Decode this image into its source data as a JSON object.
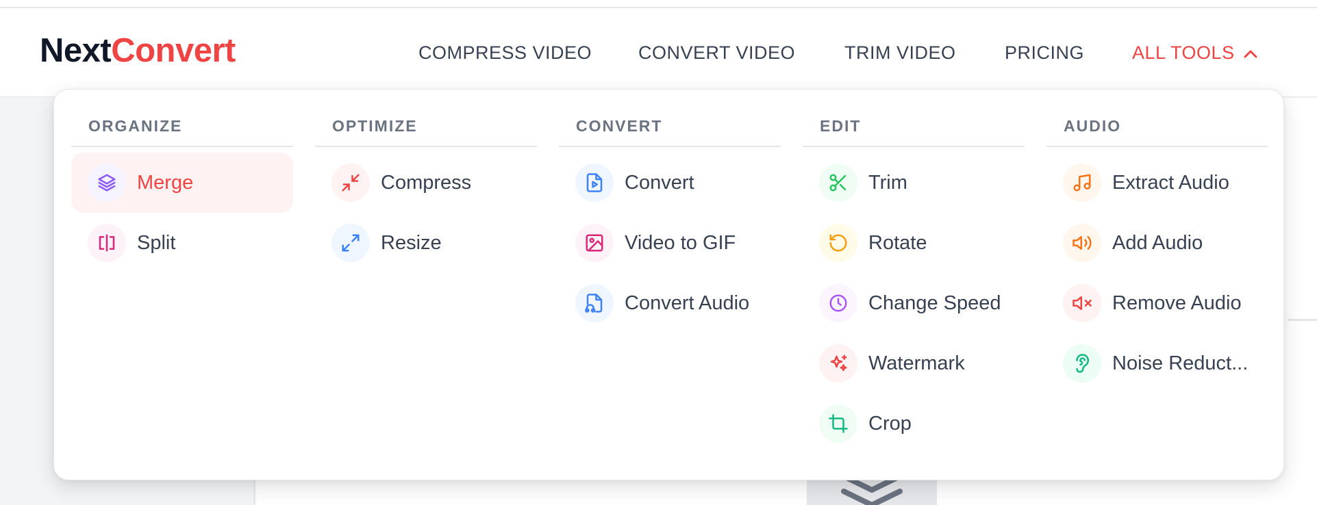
{
  "brand": {
    "name_part1": "Next",
    "name_part2": "Convert"
  },
  "nav": {
    "items": [
      {
        "label": "COMPRESS VIDEO"
      },
      {
        "label": "CONVERT VIDEO"
      },
      {
        "label": "TRIM VIDEO"
      },
      {
        "label": "PRICING"
      },
      {
        "label": "ALL TOOLS",
        "active": true,
        "icon": "chevron-up-icon"
      }
    ]
  },
  "colors": {
    "accent": "#ef4444",
    "text": "#374151",
    "muted": "#6b7280"
  },
  "menu": {
    "columns": [
      {
        "heading": "ORGANIZE",
        "items": [
          {
            "label": "Merge",
            "icon": "layers-icon",
            "active": true
          },
          {
            "label": "Split",
            "icon": "split-icon"
          }
        ]
      },
      {
        "heading": "OPTIMIZE",
        "items": [
          {
            "label": "Compress",
            "icon": "minimize-icon"
          },
          {
            "label": "Resize",
            "icon": "maximize-icon"
          }
        ]
      },
      {
        "heading": "CONVERT",
        "items": [
          {
            "label": "Convert",
            "icon": "file-video-icon"
          },
          {
            "label": "Video to GIF",
            "icon": "image-icon"
          },
          {
            "label": "Convert Audio",
            "icon": "file-audio-icon"
          }
        ]
      },
      {
        "heading": "EDIT",
        "items": [
          {
            "label": "Trim",
            "icon": "scissors-icon"
          },
          {
            "label": "Rotate",
            "icon": "rotate-ccw-icon"
          },
          {
            "label": "Change Speed",
            "icon": "clock-icon"
          },
          {
            "label": "Watermark",
            "icon": "sparkles-icon"
          },
          {
            "label": "Crop",
            "icon": "crop-icon"
          }
        ]
      },
      {
        "heading": "AUDIO",
        "items": [
          {
            "label": "Extract Audio",
            "icon": "music-icon"
          },
          {
            "label": "Add Audio",
            "icon": "volume-icon"
          },
          {
            "label": "Remove Audio",
            "icon": "volume-mute-icon"
          },
          {
            "label": "Noise Reduct...",
            "icon": "ear-icon"
          }
        ]
      }
    ]
  }
}
